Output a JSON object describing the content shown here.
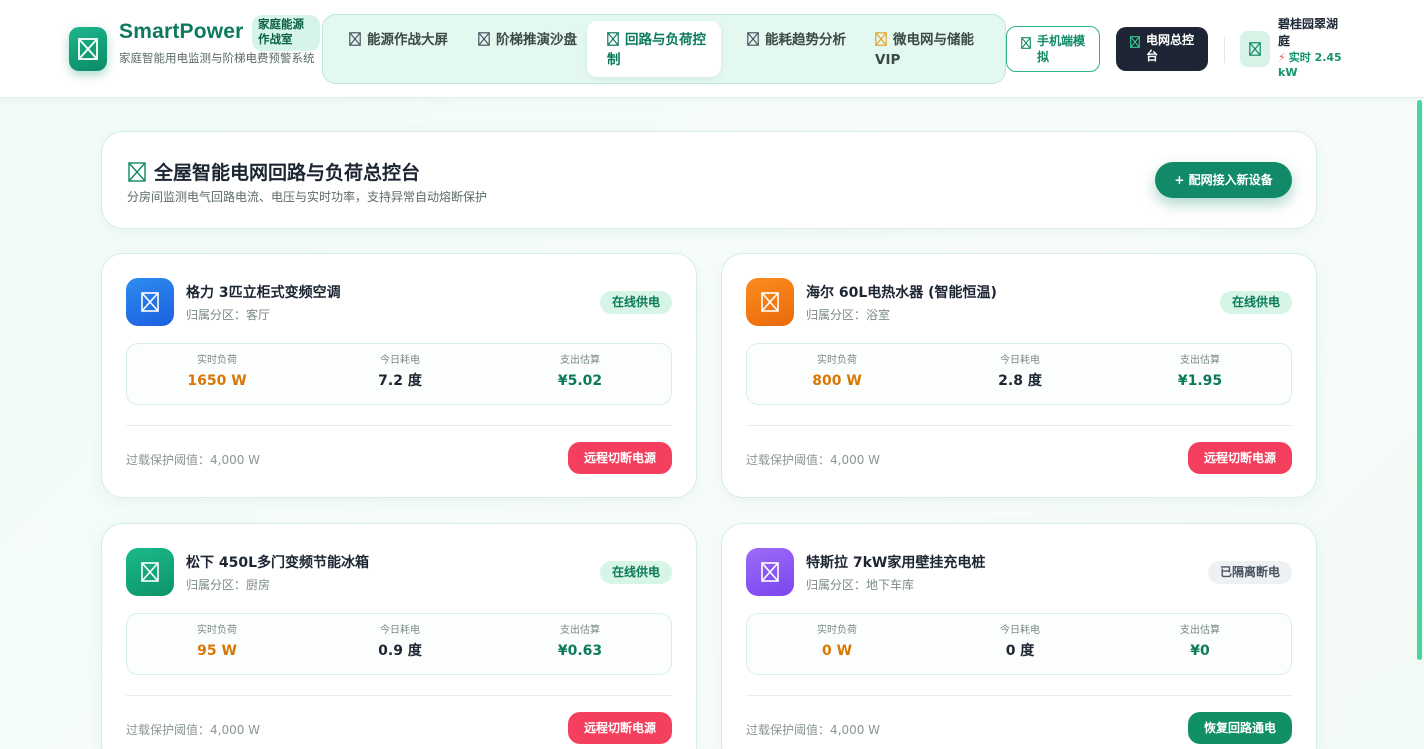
{
  "brand": {
    "name": "SmartPower",
    "badge": "家庭能源作战室",
    "subtitle": "家庭智能用电监测与阶梯电费预警系统"
  },
  "nav": {
    "items": [
      {
        "label": "能源作战大屏",
        "active": false
      },
      {
        "label": "阶梯推演沙盘",
        "active": false
      },
      {
        "label": "回路与负荷控制",
        "active": true
      },
      {
        "label": "能耗趋势分析",
        "active": false
      },
      {
        "label": "微电网与储能VIP",
        "active": false
      }
    ]
  },
  "header_actions": {
    "mobile_label": "手机端模拟",
    "grid_label": "电网总控台"
  },
  "user": {
    "community": "碧桂园翠湖庭",
    "realtime_power": "实时 2.45 kW"
  },
  "page": {
    "title": "全屋智能电网回路与负荷总控台",
    "subtitle": "分房间监测电气回路电流、电压与实时功率，支持异常自动熔断保护",
    "add_button": "+ 配网接入新设备"
  },
  "labels": {
    "load": "实时负荷",
    "energy": "今日耗电",
    "cost": "支出估算",
    "zone_prefix": "归属分区："
  },
  "colors": {
    "brand_green": "#128a69",
    "cut_red": "#f43f5e",
    "load_orange": "#d97706"
  },
  "devices": [
    {
      "name": "格力 3匹立柜式变频空调",
      "zone": "归属分区：客厅",
      "status": "在线供电",
      "online": true,
      "load": "1650 W",
      "energy": "7.2 度",
      "cost": "¥5.02",
      "threshold": "过载保护阈值：4,000 W",
      "action": "远程切断电源",
      "icon": "air-conditioner-icon",
      "icon_color": "#2563eb"
    },
    {
      "name": "海尔 60L电热水器 (智能恒温)",
      "zone": "归属分区：浴室",
      "status": "在线供电",
      "online": true,
      "load": "800 W",
      "energy": "2.8 度",
      "cost": "¥1.95",
      "threshold": "过载保护阈值：4,000 W",
      "action": "远程切断电源",
      "icon": "water-heater-icon",
      "icon_color": "#f97316"
    },
    {
      "name": "松下 450L多门变频节能冰箱",
      "zone": "归属分区：厨房",
      "status": "在线供电",
      "online": true,
      "load": "95 W",
      "energy": "0.9 度",
      "cost": "¥0.63",
      "threshold": "过载保护阈值：4,000 W",
      "action": "远程切断电源",
      "icon": "refrigerator-icon",
      "icon_color": "#10b981"
    },
    {
      "name": "特斯拉 7kW家用壁挂充电桩",
      "zone": "归属分区：地下车库",
      "status": "已隔离断电",
      "online": false,
      "load": "0 W",
      "energy": "0 度",
      "cost": "¥0",
      "threshold": "过载保护阈值：4,000 W",
      "action": "恢复回路通电",
      "icon": "ev-charger-icon",
      "icon_color": "#8b5cf6"
    }
  ]
}
